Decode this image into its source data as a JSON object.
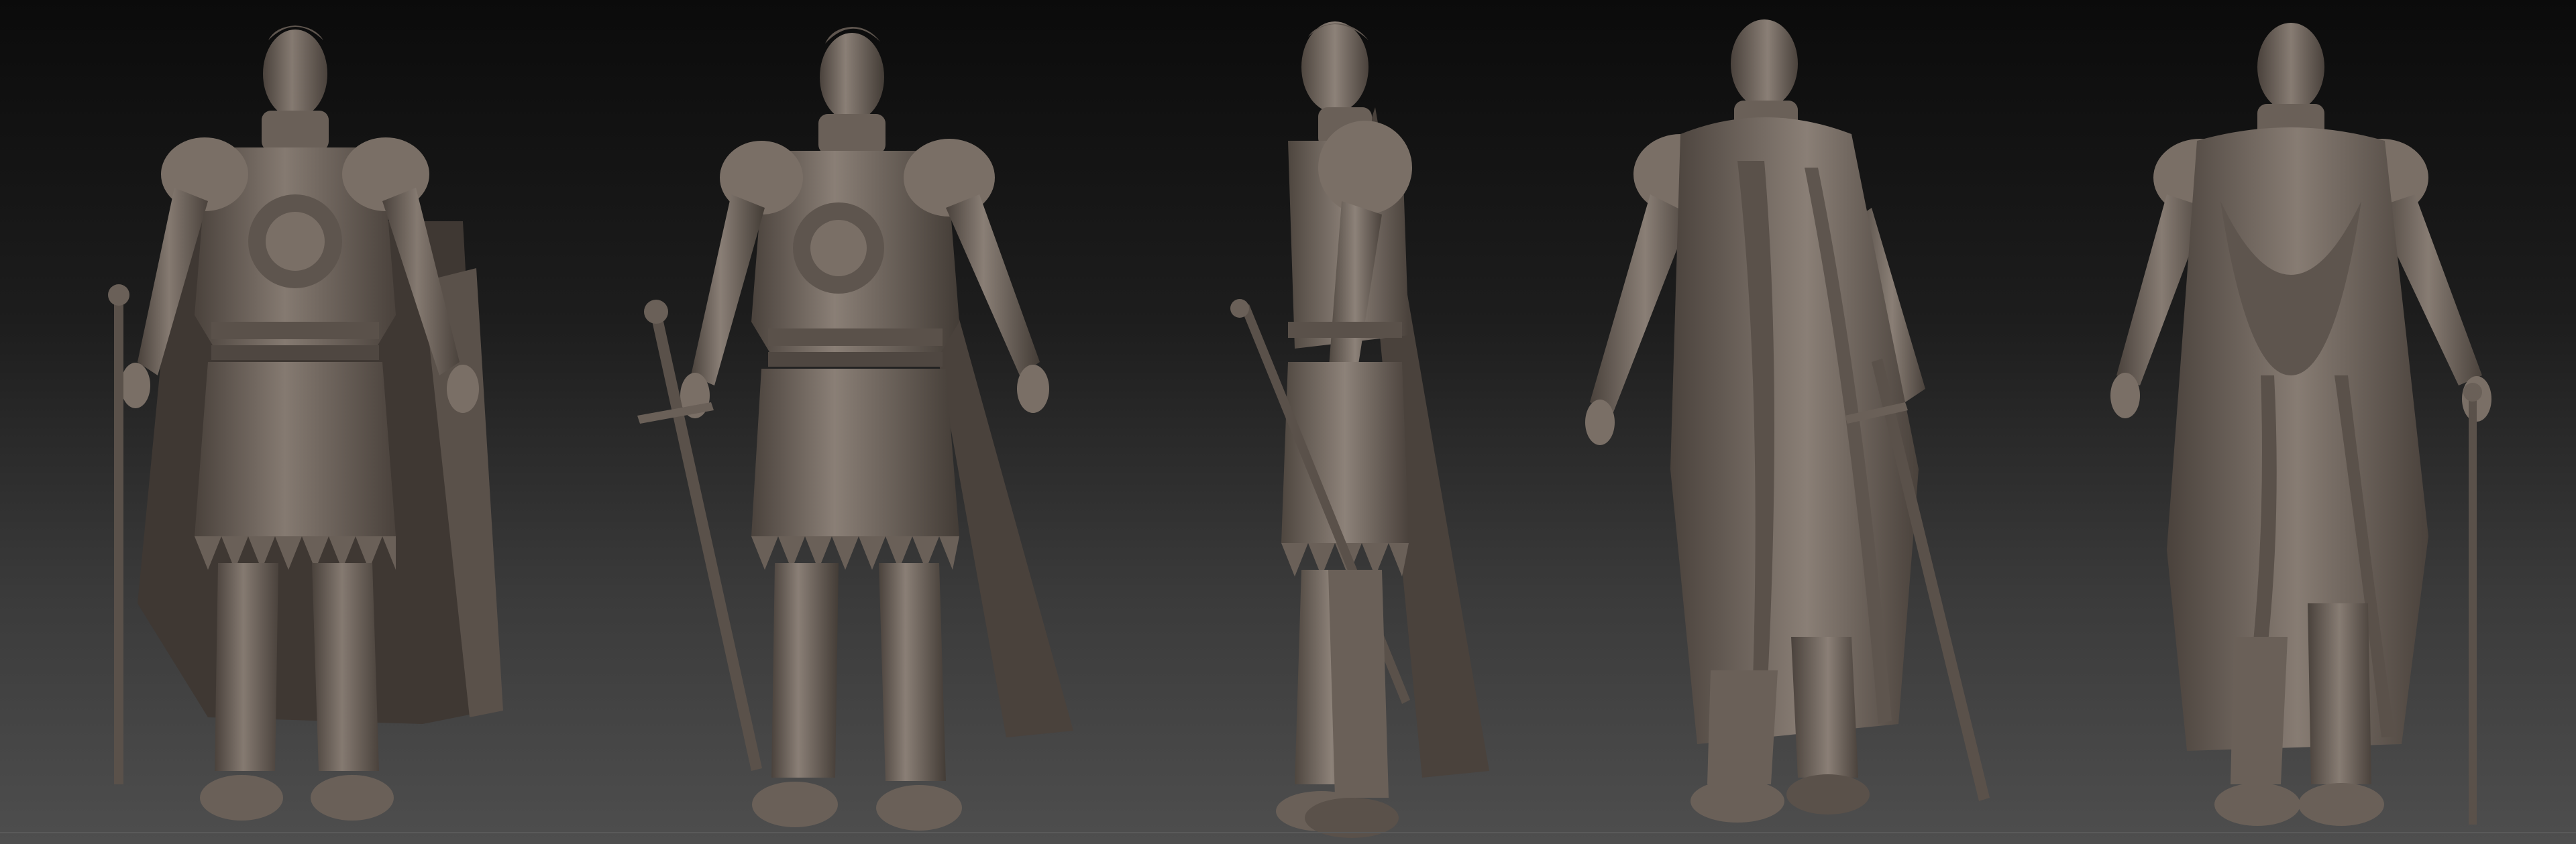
{
  "scene": {
    "description_free": true,
    "background": {
      "top_color": "#0b0b0b",
      "bottom_color": "#4e4e4e"
    },
    "material_color": "#6e645c",
    "material_highlight": "#9a8f86",
    "material_shadow": "#3a3430"
  },
  "views": [
    {
      "name": "front-view",
      "icon": "knight-front-sculpt"
    },
    {
      "name": "three-quarter-front-view",
      "icon": "knight-three-quarter-sculpt"
    },
    {
      "name": "side-view",
      "icon": "knight-side-sculpt"
    },
    {
      "name": "three-quarter-back-view",
      "icon": "knight-three-quarter-back-sculpt"
    },
    {
      "name": "back-view",
      "icon": "knight-back-sculpt"
    }
  ]
}
